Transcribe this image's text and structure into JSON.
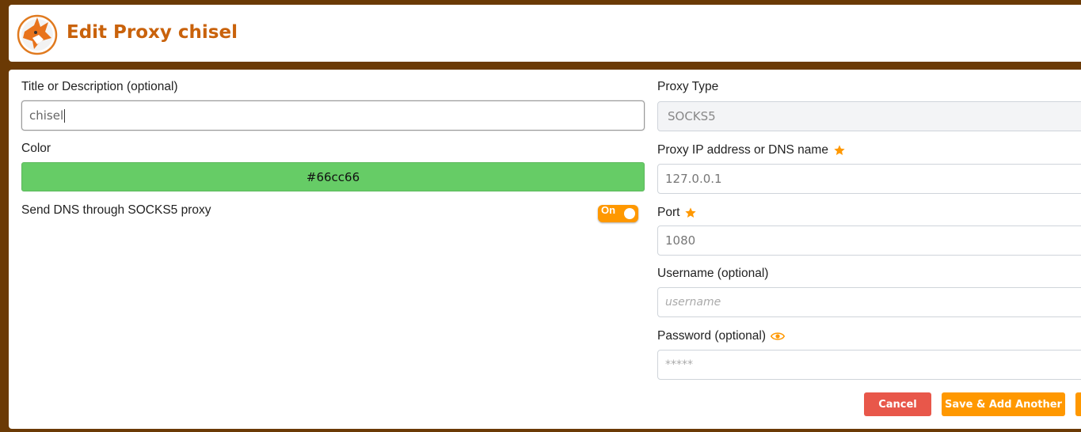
{
  "header": {
    "title": "Edit Proxy chisel"
  },
  "left": {
    "title_label": "Title or Description (optional)",
    "title_value": "chisel",
    "color_label": "Color",
    "color_value": "#66cc66",
    "dns_label": "Send DNS through SOCKS5 proxy",
    "dns_toggle": "On"
  },
  "right": {
    "type_label": "Proxy Type",
    "type_value": "SOCKS5",
    "ip_label": "Proxy IP address or DNS name",
    "ip_value": "127.0.0.1",
    "port_label": "Port",
    "port_value": "1080",
    "username_label": "Username (optional)",
    "username_placeholder": "username",
    "password_label": "Password (optional)",
    "password_placeholder": "*****"
  },
  "buttons": {
    "cancel": "Cancel",
    "save_add": "Save & Add Another"
  },
  "colors": {
    "accent": "#ff9800",
    "brand": "#c9620b",
    "danger": "#e8574a",
    "proxy_color": "#66cc66",
    "background": "#6b3a05"
  },
  "icons": {
    "logo": "foxyproxy-logo-icon",
    "required": "star-icon",
    "show_password": "eye-icon"
  }
}
